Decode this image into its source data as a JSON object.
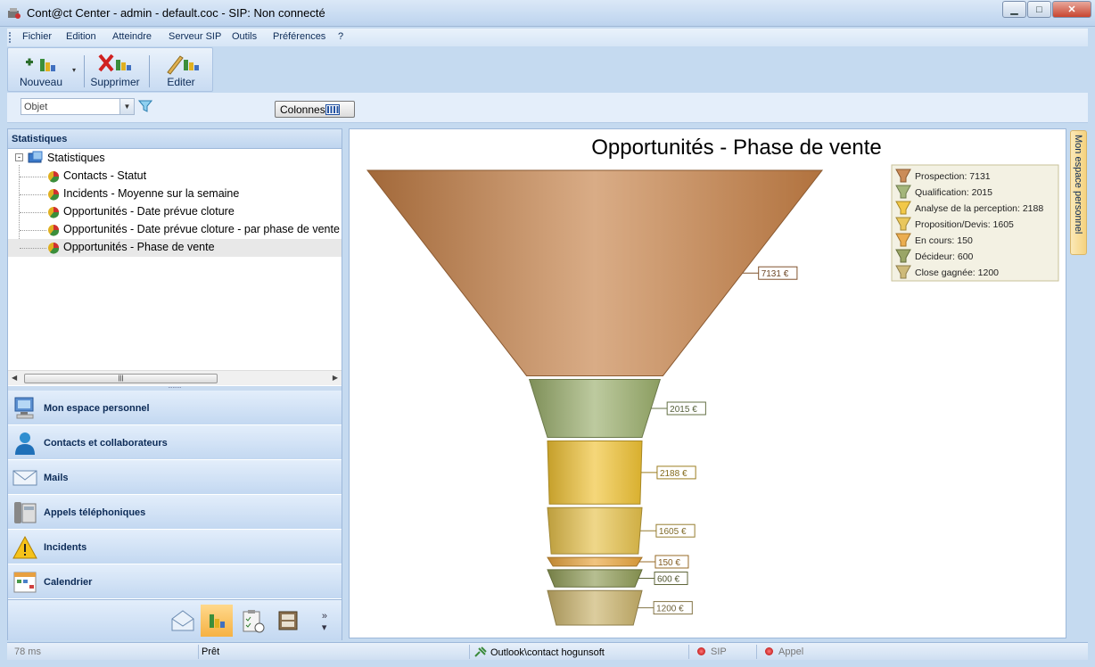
{
  "window": {
    "title": "Cont@ct Center - admin - default.coc - SIP: Non connecté"
  },
  "menu": [
    "Fichier",
    "Edition",
    "Atteindre",
    "Serveur SIP",
    "Outils",
    "Préférences",
    "?"
  ],
  "toolbar": {
    "new_label": "Nouveau",
    "delete_label": "Supprimer",
    "edit_label": "Editer"
  },
  "filter": {
    "combo_value": "Objet",
    "columns_label": "Colonnes"
  },
  "left_panel": {
    "header": "Statistiques",
    "tree_root": "Statistiques",
    "tree_items": [
      "Contacts  - Statut",
      "Incidents - Moyenne sur la semaine",
      "Opportunités - Date prévue cloture",
      "Opportunités - Date prévue cloture - par phase de vente",
      "Opportunités - Phase de vente"
    ],
    "selected_index": 4
  },
  "nav": [
    {
      "label": "Mon espace personnel",
      "icon": "computer-icon"
    },
    {
      "label": "Contacts et collaborateurs",
      "icon": "user-icon"
    },
    {
      "label": "Mails",
      "icon": "envelope-icon"
    },
    {
      "label": "Appels téléphoniques",
      "icon": "phone-icon"
    },
    {
      "label": "Incidents",
      "icon": "warning-icon"
    },
    {
      "label": "Calendrier",
      "icon": "calendar-icon"
    }
  ],
  "side_tab": {
    "label": "Mon espace personnel"
  },
  "chart_data": {
    "type": "funnel",
    "title": "Opportunités - Phase de vente",
    "categories": [
      "Prospection",
      "Qualification",
      "Analyse de la perception",
      "Proposition/Devis",
      "En cours",
      "Décideur",
      "Close gagnée"
    ],
    "values": [
      7131,
      2015,
      2188,
      1605,
      150,
      600,
      1200
    ],
    "value_labels": [
      "7131 €",
      "2015 €",
      "2188 €",
      "1605 €",
      "150 €",
      "600 €",
      "1200 €"
    ],
    "legend": [
      "Prospection: 7131",
      "Qualification: 2015",
      "Analyse de la perception: 2188",
      "Proposition/Devis: 1605",
      "En cours: 150",
      "Décideur: 600",
      "Close gagnée: 1200"
    ],
    "colors": [
      "#c57f45",
      "#9aae6b",
      "#f0c233",
      "#e6c14a",
      "#e9a43c",
      "#8f9b55",
      "#c9b26a"
    ],
    "legend_position": "top-right"
  },
  "status": {
    "latency": "78 ms",
    "state": "Prêt",
    "outlook": "Outlook\\contact hogunsoft",
    "sip": "SIP",
    "call": "Appel"
  }
}
